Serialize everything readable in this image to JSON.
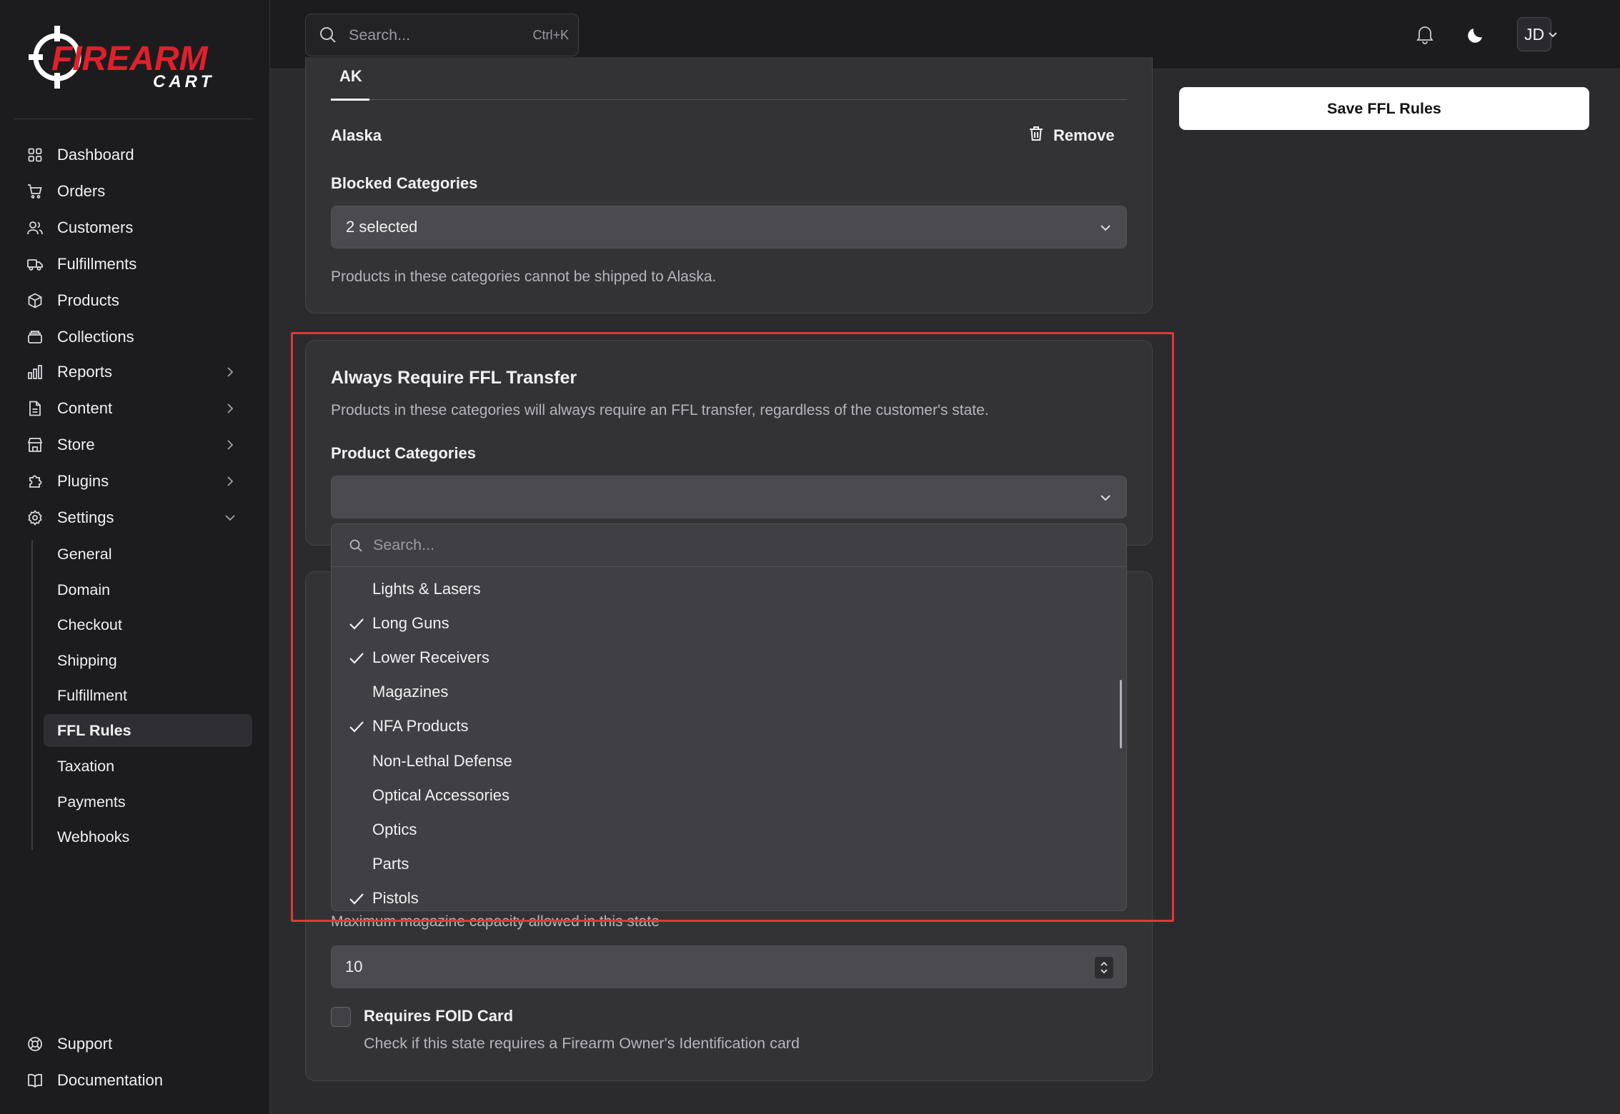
{
  "brand": {
    "name_line1": "FIREARM",
    "name_line2": "CART",
    "accent_color": "#e0202b"
  },
  "sidebar": {
    "items": [
      {
        "label": "Dashboard",
        "icon": "grid-icon"
      },
      {
        "label": "Orders",
        "icon": "cart-icon"
      },
      {
        "label": "Customers",
        "icon": "users-icon"
      },
      {
        "label": "Fulfillments",
        "icon": "truck-icon"
      },
      {
        "label": "Products",
        "icon": "box-icon"
      },
      {
        "label": "Collections",
        "icon": "layers-icon"
      },
      {
        "label": "Reports",
        "icon": "bar-chart-icon"
      },
      {
        "label": "Content",
        "icon": "document-icon"
      },
      {
        "label": "Store",
        "icon": "store-icon"
      },
      {
        "label": "Plugins",
        "icon": "puzzle-icon"
      },
      {
        "label": "Settings",
        "icon": "gear-icon"
      }
    ],
    "settings_items": [
      "General",
      "Domain",
      "Checkout",
      "Shipping",
      "Fulfillment",
      "FFL Rules",
      "Taxation",
      "Payments",
      "Webhooks"
    ],
    "active_item": "FFL Rules",
    "footer_items": [
      {
        "label": "Support",
        "icon": "lifebuoy-icon"
      },
      {
        "label": "Documentation",
        "icon": "book-icon"
      }
    ]
  },
  "topbar": {
    "search_placeholder": "Search...",
    "search_shortcut": "Ctrl+K",
    "avatar_initials": "JD"
  },
  "state_card": {
    "tab": "AK",
    "state_name": "Alaska",
    "remove_label": "Remove",
    "blocked_label": "Blocked Categories",
    "blocked_value": "2 selected",
    "blocked_help": "Products in these categories cannot be shipped to Alaska."
  },
  "save_button": "Save FFL Rules",
  "ffl_card": {
    "title": "Always Require FFL Transfer",
    "description": "Products in these categories will always require an FFL transfer, regardless of the customer's state.",
    "categories_label": "Product Categories",
    "categories_value": ""
  },
  "dropdown": {
    "search_placeholder": "Search...",
    "options": [
      {
        "label": "Lights & Lasers",
        "checked": false
      },
      {
        "label": "Long Guns",
        "checked": true
      },
      {
        "label": "Lower Receivers",
        "checked": true
      },
      {
        "label": "Magazines",
        "checked": false
      },
      {
        "label": "NFA Products",
        "checked": true
      },
      {
        "label": "Non-Lethal Defense",
        "checked": false
      },
      {
        "label": "Optical Accessories",
        "checked": false
      },
      {
        "label": "Optics",
        "checked": false
      },
      {
        "label": "Parts",
        "checked": false
      },
      {
        "label": "Pistols",
        "checked": true
      }
    ]
  },
  "magazine": {
    "help": "Maximum magazine capacity allowed in this state",
    "value": "10"
  },
  "foid": {
    "label": "Requires FOID Card",
    "help": "Check if this state requires a Firearm Owner's Identification card",
    "checked": false
  }
}
